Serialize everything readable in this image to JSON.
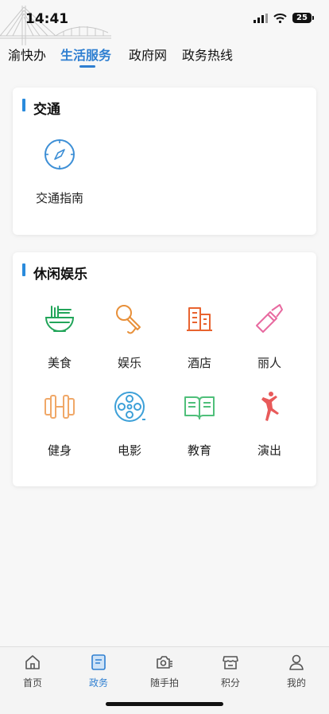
{
  "status_bar": {
    "time": "14:41",
    "battery": "25"
  },
  "top_tabs": [
    {
      "label": "渝快办",
      "active": false
    },
    {
      "label": "生活服务",
      "active": true
    },
    {
      "label": "政府网",
      "active": false
    },
    {
      "label": "政务热线",
      "active": false
    }
  ],
  "sections": {
    "traffic": {
      "title": "交通",
      "items": [
        {
          "label": "交通指南",
          "icon": "compass-icon"
        }
      ]
    },
    "leisure": {
      "title": "休闲娱乐",
      "items": [
        {
          "label": "美食",
          "icon": "noodle-bowl-icon"
        },
        {
          "label": "娱乐",
          "icon": "microphone-icon"
        },
        {
          "label": "酒店",
          "icon": "hotel-building-icon"
        },
        {
          "label": "丽人",
          "icon": "lipstick-icon"
        },
        {
          "label": "健身",
          "icon": "dumbbell-icon"
        },
        {
          "label": "电影",
          "icon": "film-reel-icon"
        },
        {
          "label": "教育",
          "icon": "open-book-icon"
        },
        {
          "label": "演出",
          "icon": "dancer-icon"
        }
      ]
    }
  },
  "bottom_nav": [
    {
      "label": "首页",
      "icon": "home-icon",
      "active": false
    },
    {
      "label": "政务",
      "icon": "document-icon",
      "active": true
    },
    {
      "label": "随手拍",
      "icon": "camera-icon",
      "active": false
    },
    {
      "label": "积分",
      "icon": "store-icon",
      "active": false
    },
    {
      "label": "我的",
      "icon": "user-icon",
      "active": false
    }
  ],
  "colors": {
    "accent": "#2f7fd1",
    "food": "#22a55a",
    "entertainment": "#e8903a",
    "hotel": "#e8632f",
    "beauty": "#e86aa0",
    "fitness": "#f0a868",
    "movie": "#3da0d8",
    "education": "#4fbf7a",
    "performance": "#e85a5a"
  }
}
